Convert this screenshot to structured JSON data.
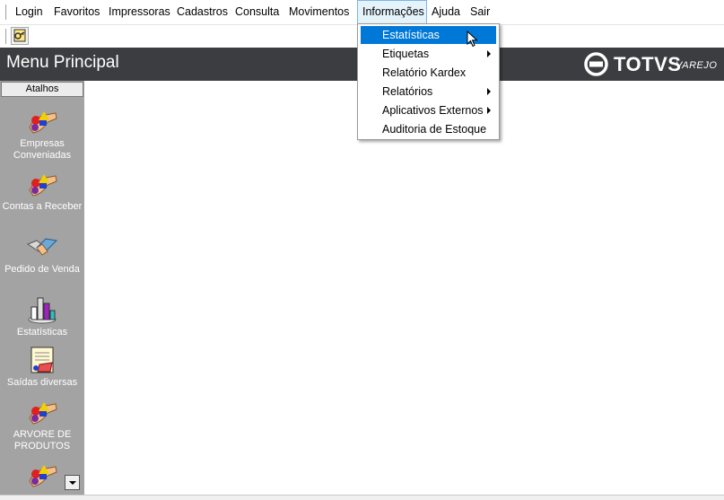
{
  "menubar": {
    "items": [
      {
        "label": "Login"
      },
      {
        "label": "Favoritos"
      },
      {
        "label": "Impressoras"
      },
      {
        "label": "Cadastros"
      },
      {
        "label": "Consulta"
      },
      {
        "label": "Movimentos"
      },
      {
        "label": "Informações"
      },
      {
        "label": "Ajuda"
      },
      {
        "label": "Sair"
      }
    ]
  },
  "header": {
    "title": "Menu Principal",
    "brand": "TOTVS",
    "brand_sub": "VAREJO",
    "bg_color": "#3b3d40"
  },
  "sidebar": {
    "header": "Atalhos",
    "items": [
      {
        "label": "Empresas Conveniadas",
        "icon": "shapes-hand-icon"
      },
      {
        "label": "Contas a Receber",
        "icon": "shapes-hand-icon"
      },
      {
        "label": "Pedido de Venda",
        "icon": "handshake-icon"
      },
      {
        "label": "Estatísticas",
        "icon": "bar-chart-icon"
      },
      {
        "label": "Saídas diversas",
        "icon": "document-icon"
      },
      {
        "label": "ARVORE DE PRODUTOS",
        "icon": "shapes-hand-icon"
      },
      {
        "label": "",
        "icon": "shapes-hand-icon"
      }
    ]
  },
  "dropdown": {
    "items": [
      {
        "label": "Estatísticas",
        "highlighted": true
      },
      {
        "label": "Etiquetas",
        "submenu": true
      },
      {
        "label": "Relatório Kardex"
      },
      {
        "label": "Relatórios",
        "submenu": true
      },
      {
        "label": "Aplicativos Externos",
        "submenu": true
      },
      {
        "label": "Auditoria de Estoque"
      }
    ],
    "highlight_color": "#0078d7"
  }
}
